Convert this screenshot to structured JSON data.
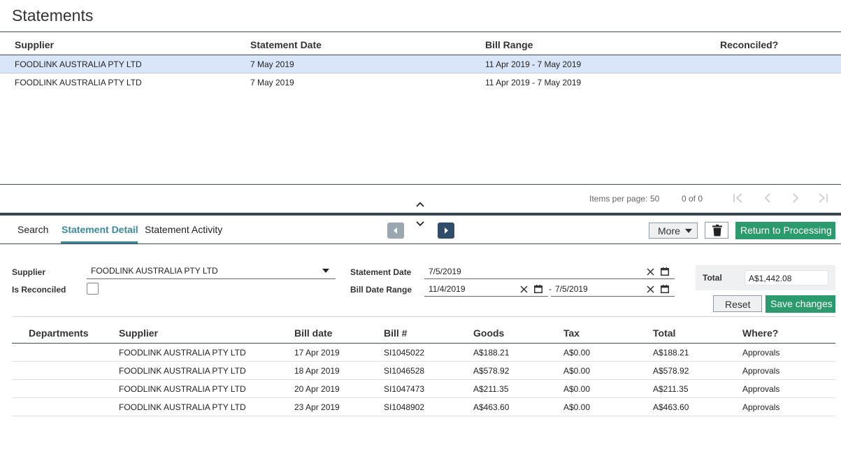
{
  "page": {
    "title": "Statements"
  },
  "statements": {
    "columns": [
      "Supplier",
      "Statement Date",
      "Bill Range",
      "Reconciled?"
    ],
    "rows": [
      {
        "supplier": "FOODLINK AUSTRALIA PTY LTD",
        "statement_date": "7 May 2019",
        "bill_range": "11 Apr 2019 - 7 May 2019",
        "reconciled": ""
      },
      {
        "supplier": "FOODLINK AUSTRALIA PTY LTD",
        "statement_date": "7 May 2019",
        "bill_range": "11 Apr 2019 - 7 May 2019",
        "reconciled": ""
      }
    ],
    "selected_row": 0
  },
  "pager": {
    "items_per_page_label": "Items per page:",
    "items_per_page": "50",
    "range": "0 of 0"
  },
  "tabs": [
    {
      "label": "Search"
    },
    {
      "label": "Statement Detail",
      "active": true
    },
    {
      "label": "Statement Activity"
    }
  ],
  "toolbar": {
    "more_label": "More",
    "return_label": "Return to Processing"
  },
  "detail": {
    "supplier_label": "Supplier",
    "supplier_value": "FOODLINK AUSTRALIA PTY LTD",
    "is_reconciled_label": "Is Reconciled",
    "is_reconciled": false,
    "statement_date_label": "Statement Date",
    "statement_date_value": "7/5/2019",
    "bill_date_range_label": "Bill Date Range",
    "bill_date_from": "11/4/2019",
    "range_separator": "-",
    "bill_date_to": "7/5/2019",
    "total_label": "Total",
    "total_value": "A$1,442.08",
    "reset_label": "Reset",
    "save_label": "Save changes"
  },
  "bills": {
    "columns": [
      "Departments",
      "Supplier",
      "Bill date",
      "Bill #",
      "Goods",
      "Tax",
      "Total",
      "Where?"
    ],
    "rows": [
      {
        "department": "",
        "supplier": "FOODLINK AUSTRALIA PTY LTD",
        "bill_date": "17 Apr 2019",
        "bill_no": "SI1045022",
        "goods": "A$188.21",
        "tax": "A$0.00",
        "total": "A$188.21",
        "where": "Approvals"
      },
      {
        "department": "",
        "supplier": "FOODLINK AUSTRALIA PTY LTD",
        "bill_date": "18 Apr 2019",
        "bill_no": "SI1046528",
        "goods": "A$578.92",
        "tax": "A$0.00",
        "total": "A$578.92",
        "where": "Approvals"
      },
      {
        "department": "",
        "supplier": "FOODLINK AUSTRALIA PTY LTD",
        "bill_date": "20 Apr 2019",
        "bill_no": "SI1047473",
        "goods": "A$211.35",
        "tax": "A$0.00",
        "total": "A$211.35",
        "where": "Approvals"
      },
      {
        "department": "",
        "supplier": "FOODLINK AUSTRALIA PTY LTD",
        "bill_date": "23 Apr 2019",
        "bill_no": "SI1048902",
        "goods": "A$463.60",
        "tax": "A$0.00",
        "total": "A$463.60",
        "where": "Approvals"
      }
    ]
  },
  "colors": {
    "accent_teal": "#3a8a99",
    "primary_green": "#2b9a6c",
    "selected_row": "#d9e5f9",
    "splitter": "#36454f"
  }
}
